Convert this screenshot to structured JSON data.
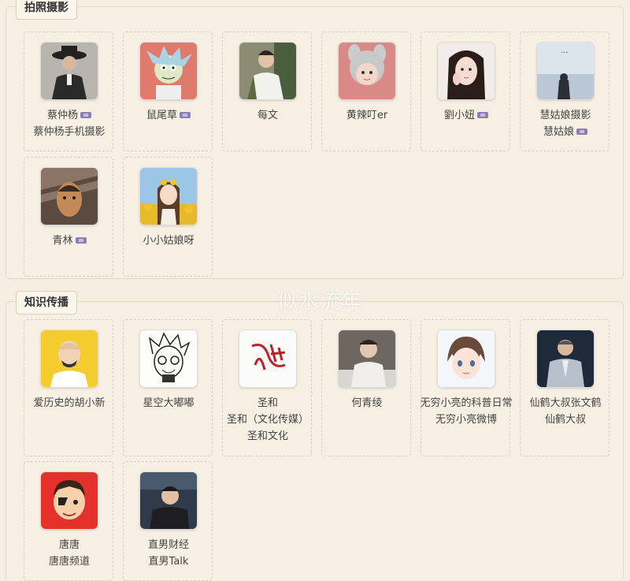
{
  "sections": [
    {
      "title": "拍照摄影",
      "cards": [
        {
          "line1": "蔡仲杨",
          "badge1": true,
          "line2": "蔡仲杨手机摄影",
          "badge2": false,
          "avatar": "man-in-hat-avatar"
        },
        {
          "line1": "鼠尾草",
          "badge1": true,
          "line2": "",
          "badge2": false,
          "avatar": "cartoon-scientist-avatar"
        },
        {
          "line1": "每文",
          "badge1": false,
          "line2": "",
          "badge2": false,
          "avatar": "man-outdoors-avatar"
        },
        {
          "line1": "黄辣叮er",
          "badge1": false,
          "line2": "",
          "badge2": false,
          "avatar": "girl-bunny-hat-avatar"
        },
        {
          "line1": "劉小妞",
          "badge1": true,
          "line2": "",
          "badge2": false,
          "avatar": "girl-portrait-avatar"
        },
        {
          "line1": "慧姑娘摄影",
          "badge1": false,
          "line2": "慧姑娘",
          "badge2": true,
          "avatar": "sea-silhouette-avatar"
        },
        {
          "line1": "青林",
          "badge1": true,
          "line2": "",
          "badge2": false,
          "avatar": "shadow-face-avatar"
        },
        {
          "line1": "小小姑娘呀",
          "badge1": false,
          "line2": "",
          "badge2": false,
          "avatar": "sunflower-girl-avatar"
        }
      ]
    },
    {
      "title": "知识传播",
      "cards": [
        {
          "line1": "爱历史的胡小新",
          "badge1": false,
          "line2": "",
          "badge2": false,
          "avatar": "bald-man-cartoon-avatar"
        },
        {
          "line1": "星空大嘟嘟",
          "badge1": false,
          "line2": "",
          "badge2": false,
          "avatar": "glasses-sketch-avatar"
        },
        {
          "line1": "圣和",
          "badge1": false,
          "line2": "圣和（文化传媒）",
          "badge2": false,
          "line3": "圣和文化",
          "avatar": "red-seal-avatar"
        },
        {
          "line1": "何青绫",
          "badge1": false,
          "line2": "",
          "badge2": false,
          "avatar": "man-reading-avatar"
        },
        {
          "line1": "无穷小亮的科普日常",
          "badge1": false,
          "line2": "无穷小亮微博",
          "badge2": false,
          "avatar": "anime-boy-avatar"
        },
        {
          "line1": "仙鹤大叔张文鹤",
          "badge1": false,
          "line2": "仙鹤大叔",
          "badge2": false,
          "avatar": "man-in-suit-avatar"
        },
        {
          "line1": "唐唐",
          "badge1": false,
          "line2": "唐唐频道",
          "badge2": false,
          "avatar": "cartoon-boy-red-avatar"
        },
        {
          "line1": "直男财经",
          "badge1": false,
          "line2": "直男Talk",
          "badge2": false,
          "avatar": "man-in-studio-avatar"
        }
      ]
    }
  ],
  "watermark": "似水流年",
  "colors": {
    "page_bg": "#f6efe1",
    "badge": "#8d7fb6",
    "text": "#444444"
  }
}
